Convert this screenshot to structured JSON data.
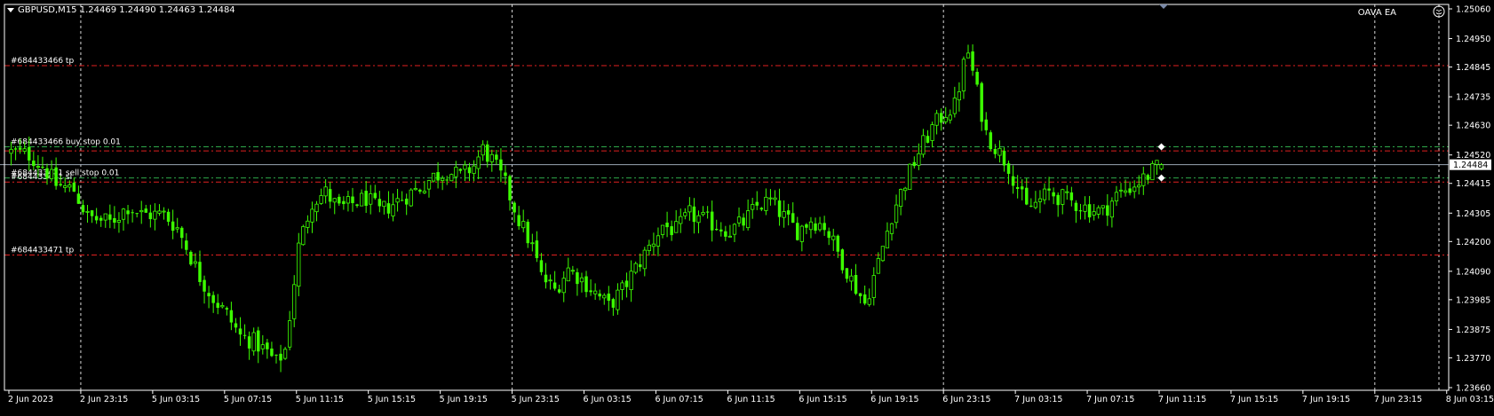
{
  "header": {
    "symbol_line": "GBPUSD,M15  1.24469 1.24490 1.24463 1.24484",
    "ea_label": "OAVA EA"
  },
  "chart_data": {
    "type": "candlestick",
    "symbol": "GBPUSD",
    "timeframe": "M15",
    "ohlc_header": {
      "open": 1.24469,
      "high": 1.2449,
      "low": 1.24463,
      "close": 1.24484
    },
    "current_price": 1.24484,
    "current_price_label": "1.24484",
    "ylim": [
      1.2366,
      1.2506
    ],
    "y_ticks": [
      "1.25060",
      "1.24950",
      "1.24845",
      "1.24735",
      "1.24630",
      "1.24520",
      "1.24415",
      "1.24305",
      "1.24200",
      "1.24090",
      "1.23985",
      "1.23875",
      "1.23770",
      "1.23660"
    ],
    "x_ticks": [
      "2 Jun 2023",
      "2 Jun 23:15",
      "5 Jun 03:15",
      "5 Jun 07:15",
      "5 Jun 11:15",
      "5 Jun 15:15",
      "5 Jun 19:15",
      "5 Jun 23:15",
      "6 Jun 03:15",
      "6 Jun 07:15",
      "6 Jun 11:15",
      "6 Jun 15:15",
      "6 Jun 19:15",
      "6 Jun 23:15",
      "7 Jun 03:15",
      "7 Jun 07:15",
      "7 Jun 11:15",
      "7 Jun 15:15",
      "7 Jun 19:15",
      "7 Jun 23:15",
      "8 Jun 03:15"
    ],
    "period_separators": [
      "2 Jun 23:15",
      "5 Jun 23:15",
      "6 Jun 23:15",
      "7 Jun 23:15"
    ],
    "order_lines": [
      {
        "label": "#684433466 tp",
        "price": 1.2485,
        "color": "#e02020",
        "style": "dashdot"
      },
      {
        "label": "#684433466 buy stop 0.01",
        "price": 1.2455,
        "color": "#2fa84a",
        "style": "dashdot"
      },
      {
        "label": "",
        "price": 1.24535,
        "color": "#e02020",
        "style": "dashdot"
      },
      {
        "label": "#684433471 sell stop 0.01",
        "price": 1.24435,
        "color": "#2fa84a",
        "style": "dashdot"
      },
      {
        "label": "#684433471 sl",
        "price": 1.2442,
        "color": "#e02020",
        "style": "dashdot"
      },
      {
        "label": "#684433471 tp",
        "price": 1.2415,
        "color": "#e02020",
        "style": "dashdot"
      }
    ],
    "path_anchors": [
      [
        0,
        1.2453
      ],
      [
        4,
        1.2452
      ],
      [
        7,
        1.2448
      ],
      [
        10,
        1.2441
      ],
      [
        14,
        1.2439
      ],
      [
        17,
        1.2429
      ],
      [
        22,
        1.2427
      ],
      [
        26,
        1.2433
      ],
      [
        29,
        1.243
      ],
      [
        34,
        1.243
      ],
      [
        37,
        1.2425
      ],
      [
        39,
        1.2418
      ],
      [
        42,
        1.2407
      ],
      [
        45,
        1.2399
      ],
      [
        48,
        1.2393
      ],
      [
        51,
        1.2385
      ],
      [
        54,
        1.2383
      ],
      [
        57,
        1.2379
      ],
      [
        59,
        1.2375
      ],
      [
        61,
        1.238
      ],
      [
        64,
        1.2418
      ],
      [
        67,
        1.2435
      ],
      [
        70,
        1.2438
      ],
      [
        73,
        1.2432
      ],
      [
        76,
        1.2434
      ],
      [
        79,
        1.2436
      ],
      [
        82,
        1.2431
      ],
      [
        85,
        1.2434
      ],
      [
        88,
        1.2437
      ],
      [
        91,
        1.244
      ],
      [
        94,
        1.2444
      ],
      [
        97,
        1.2446
      ],
      [
        100,
        1.2444
      ],
      [
        103,
        1.2448
      ],
      [
        105,
        1.2454
      ],
      [
        107,
        1.245
      ],
      [
        110,
        1.2441
      ],
      [
        113,
        1.2428
      ],
      [
        116,
        1.2418
      ],
      [
        118,
        1.2407
      ],
      [
        121,
        1.2402
      ],
      [
        124,
        1.241
      ],
      [
        127,
        1.2406
      ],
      [
        130,
        1.2401
      ],
      [
        133,
        1.2396
      ],
      [
        136,
        1.2402
      ],
      [
        139,
        1.241
      ],
      [
        142,
        1.2418
      ],
      [
        145,
        1.2426
      ],
      [
        148,
        1.2424
      ],
      [
        151,
        1.243
      ],
      [
        154,
        1.2428
      ],
      [
        157,
        1.2426
      ],
      [
        160,
        1.2424
      ],
      [
        163,
        1.2427
      ],
      [
        166,
        1.2433
      ],
      [
        169,
        1.2435
      ],
      [
        172,
        1.2429
      ],
      [
        175,
        1.2424
      ],
      [
        178,
        1.2428
      ],
      [
        181,
        1.2426
      ],
      [
        184,
        1.2416
      ],
      [
        187,
        1.2406
      ],
      [
        190,
        1.2397
      ],
      [
        193,
        1.2412
      ],
      [
        196,
        1.243
      ],
      [
        199,
        1.2442
      ],
      [
        202,
        1.2453
      ],
      [
        205,
        1.2462
      ],
      [
        208,
        1.2468
      ],
      [
        210,
        1.247
      ],
      [
        212,
        1.2485
      ],
      [
        213,
        1.249
      ],
      [
        215,
        1.2475
      ],
      [
        217,
        1.246
      ],
      [
        219,
        1.2455
      ],
      [
        222,
        1.2448
      ],
      [
        224,
        1.244
      ],
      [
        226,
        1.2432
      ],
      [
        228,
        1.2434
      ],
      [
        231,
        1.2438
      ],
      [
        234,
        1.2436
      ],
      [
        237,
        1.2434
      ],
      [
        240,
        1.2432
      ],
      [
        243,
        1.2431
      ],
      [
        246,
        1.2437
      ],
      [
        249,
        1.244
      ],
      [
        252,
        1.2443
      ],
      [
        254,
        1.2446
      ],
      [
        256,
        1.2448
      ]
    ]
  }
}
